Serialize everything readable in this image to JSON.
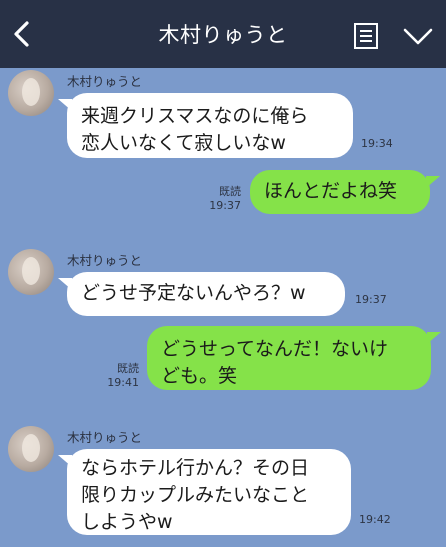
{
  "header": {
    "title": "木村りゅうと",
    "back_icon": "back-chevron-icon",
    "menu_icon": "note-list-icon",
    "expand_icon": "chevron-down-icon"
  },
  "messages": [
    {
      "side": "in",
      "sender": "木村りゅうと",
      "text": "来週クリスマスなのに俺ら\n恋人いなくて寂しいなw",
      "time": "19:34"
    },
    {
      "side": "out",
      "read": "既読",
      "text": "ほんとだよね笑",
      "time": "19:37"
    },
    {
      "side": "in",
      "sender": "木村りゅうと",
      "text": "どうせ予定ないんやろ？w",
      "time": "19:37"
    },
    {
      "side": "out",
      "read": "既読",
      "text": "どうせってなんだ！ないけ\nども。笑",
      "time": "19:41"
    },
    {
      "side": "in",
      "sender": "木村りゅうと",
      "text": "ならホテル行かん？その日\n限りカップルみたいなこと\nしようやw",
      "time": "19:42"
    }
  ],
  "colors": {
    "header_bg": "#283146",
    "chat_bg": "#7b9acb",
    "incoming_bubble": "#ffffff",
    "outgoing_bubble": "#85e249"
  }
}
